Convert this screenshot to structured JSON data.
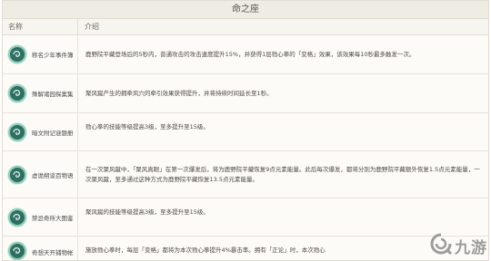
{
  "title": "命之座",
  "columns": {
    "name": "名称",
    "desc": "介绍"
  },
  "rows": [
    {
      "name": "称名少年事件簿",
      "desc": "鹿野院平藏登场后的5秒内，普通攻击的攻击速度提升15%，并获得1层勠心拳的「变格」效果，该效果每10秒最多触发一次。",
      "icon": "wind-swirl-icon"
    },
    {
      "name": "殊解诸园探案集",
      "desc": "聚风蹴产生的拥牵风穴的牵引效果获得提升，并将持续时间延长至1秒。",
      "icon": "wind-swirl-icon"
    },
    {
      "name": "暗文附记谜题册",
      "desc": "勠心拳的技能等级提高3级，至多提升至15级。",
      "icon": "wind-swirl-icon"
    },
    {
      "name": "虚诡朔谈百物语",
      "desc": "在一次聚风蹴中，「聚风真眼」在第一次爆发后，将为鹿野院平藏恢复9点元素能量。此后每次爆发，都将分别为鹿野院平藏额外恢复1.5点元素能量，一次聚风蹴，至多通过这种方式为鹿野院平藏恢复13.5点元素能量。",
      "icon": "wind-swirl-icon"
    },
    {
      "name": "禁忌奇所大图鉴",
      "desc": "聚风蹴的技能等级提高3级，至多提升至15级。",
      "icon": "wind-swirl-icon"
    },
    {
      "name": "奇想天开捕物帐",
      "desc": "施放勠心拳时，每层「变格」都将为本次勠心拳提升4%暴击率。拥有「正论」时，本次勠心",
      "icon": "wind-swirl-icon"
    }
  ],
  "watermark": {
    "text": "九游",
    "icon": "jiuyou-logo-icon"
  }
}
